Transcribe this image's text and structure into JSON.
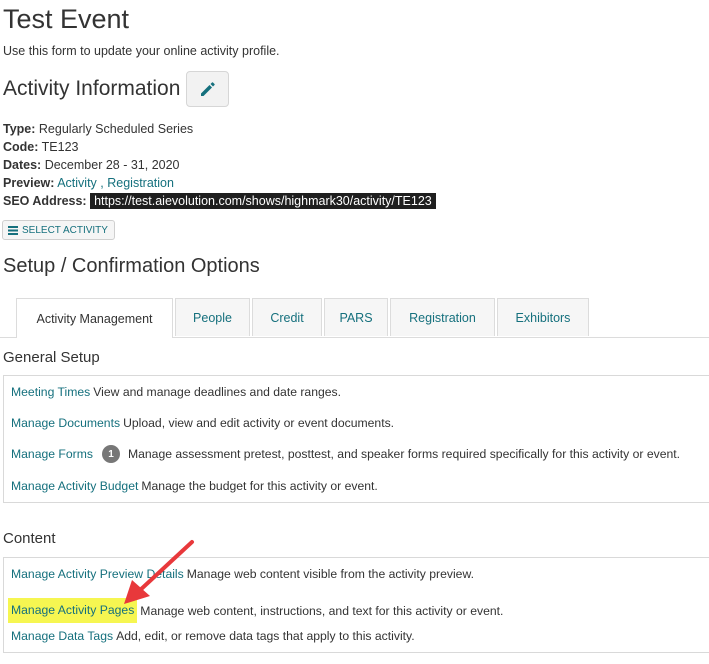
{
  "page": {
    "title": "Test Event",
    "intro": "Use this form to update your online activity profile."
  },
  "activity_info": {
    "title": "Activity Information",
    "edit_icon": "pencil-icon",
    "type_label": "Type:",
    "type_value": "Regularly Scheduled Series",
    "code_label": "Code:",
    "code_value": "TE123",
    "dates_label": "Dates:",
    "dates_value": "December 28 - 31, 2020",
    "preview_label": "Preview:",
    "preview_activity": "Activity",
    "preview_sep": " , ",
    "preview_registration": "Registration",
    "seo_label": "SEO Address:",
    "seo_value": "https://test.aievolution.com/shows/highmark30/activity/TE123",
    "select_button": "SELECT ACTIVITY",
    "select_icon": "list-icon"
  },
  "setup": {
    "title": "Setup / Confirmation Options",
    "tabs": [
      {
        "label": "Activity Management",
        "active": true
      },
      {
        "label": "People",
        "active": false
      },
      {
        "label": "Credit",
        "active": false
      },
      {
        "label": "PARS",
        "active": false
      },
      {
        "label": "Registration",
        "active": false
      },
      {
        "label": "Exhibitors",
        "active": false
      }
    ]
  },
  "general_setup": {
    "title": "General Setup",
    "items": [
      {
        "link": "Meeting Times",
        "desc": "View and manage deadlines and date ranges."
      },
      {
        "link": "Manage Documents",
        "desc": "Upload, view and edit activity or event documents."
      },
      {
        "link": "Manage Forms",
        "badge": "1",
        "desc": "Manage assessment pretest, posttest, and speaker forms required specifically for this activity or event."
      },
      {
        "link": "Manage Activity Budget",
        "desc": "Manage the budget for this activity or event."
      }
    ]
  },
  "content": {
    "title": "Content",
    "items": [
      {
        "link": "Manage Activity Preview Details",
        "desc": "Manage web content visible from the activity preview."
      },
      {
        "link": "Manage Activity Pages",
        "desc": "Manage web content, instructions, and text for this activity or event.",
        "highlighted": true
      },
      {
        "link": "Manage Data Tags",
        "desc": "Add, edit, or remove data tags that apply to this activity."
      }
    ]
  },
  "colors": {
    "link": "#15707d",
    "highlight": "#f6f651",
    "arrow": "#e8383b",
    "badge": "#777777"
  }
}
